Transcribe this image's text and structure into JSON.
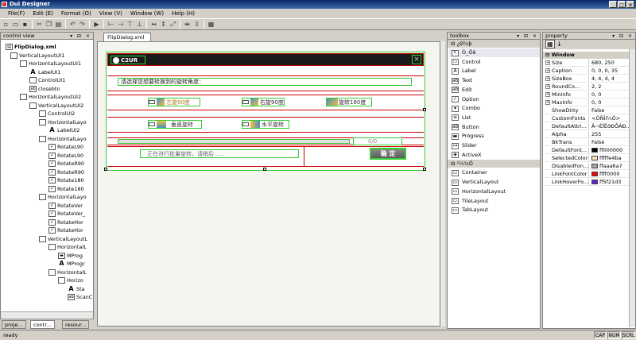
{
  "app": {
    "title": "Dui Designer",
    "window_buttons": [
      "_",
      "□",
      "×"
    ]
  },
  "menu": [
    "File(F)",
    "Edit (E)",
    "Format (O)",
    "View (V)",
    "Window (W)",
    "Help (H)"
  ],
  "toolbar_icons": [
    "new-icon",
    "open-icon",
    "save-icon",
    "cut-icon",
    "copy-icon",
    "paste-icon",
    "undo-icon",
    "redo-icon",
    "run-icon",
    "align-left-icon",
    "align-right-icon",
    "align-top-icon",
    "align-bottom-icon",
    "same-width-icon",
    "same-height-icon",
    "same-size-icon",
    "center-h-icon",
    "center-v-icon",
    "grid-icon"
  ],
  "control_view": {
    "title": "control view",
    "header_buttons": "▾ ⊟ ×",
    "tree": [
      {
        "label": "FlipDialog.xml",
        "icon": "xml",
        "bold": true
      },
      {
        "label": "VerticalLayoutUI1",
        "icon": "ctrl"
      },
      {
        "label": "HorizontalLayoutUI1",
        "icon": "ctrl"
      },
      {
        "label": "LabelUI1",
        "icon": "A"
      },
      {
        "label": "ControlUI1",
        "icon": "ctrl"
      },
      {
        "label": "closebtn",
        "icon": "ab"
      },
      {
        "label": "HorizontalLayoutUI2",
        "icon": "ctrl"
      },
      {
        "label": "VerticalLayoutUI2",
        "icon": "ctrl"
      },
      {
        "label": "ControlUI2",
        "icon": "ctrl"
      },
      {
        "label": "HorizontalLayo",
        "icon": "ctrl"
      },
      {
        "label": "LabelUI2",
        "icon": "A"
      },
      {
        "label": "HorizontalLayo",
        "icon": "ctrl"
      },
      {
        "label": "RotateL90",
        "icon": "chk"
      },
      {
        "label": "RotateL90",
        "icon": "chk"
      },
      {
        "label": "RotateR90",
        "icon": "chk"
      },
      {
        "label": "RotateR90",
        "icon": "chk"
      },
      {
        "label": "Rotate180",
        "icon": "chk"
      },
      {
        "label": "Rotate180",
        "icon": "chk"
      },
      {
        "label": "HorizontalLayo",
        "icon": "ctrl"
      },
      {
        "label": "RotateVer",
        "icon": "chk"
      },
      {
        "label": "RotateVer_",
        "icon": "chk"
      },
      {
        "label": "RotateHor",
        "icon": "chk"
      },
      {
        "label": "RotateHor",
        "icon": "chk"
      },
      {
        "label": "VerticalLayoutL",
        "icon": "ctrl"
      },
      {
        "label": "HorizontalL",
        "icon": "ctrl"
      },
      {
        "label": "MProg",
        "icon": "bar"
      },
      {
        "label": "MProgr",
        "icon": "A"
      },
      {
        "label": "HorizontalL",
        "icon": "ctrl"
      },
      {
        "label": "Horizo",
        "icon": "ctrl"
      },
      {
        "label": "Sta",
        "icon": "A"
      },
      {
        "label": "ScanC",
        "icon": "ab"
      }
    ],
    "tabs": [
      "proje...",
      "contr...",
      "resour..."
    ]
  },
  "document_tab": {
    "label": "FlipDialog.xml",
    "close": "×"
  },
  "dialog_preview": {
    "logo": "C2UR",
    "prompt": "请选择您想要转换到的旋转角度：",
    "options_row1": [
      "左旋90度",
      "右旋90度",
      "旋转180度"
    ],
    "options_row2": [
      "垂直旋转",
      "水平旋转"
    ],
    "progress_text": "0/0",
    "status_text": "正在进行批量旋转，请稍后......",
    "confirm_button": "确 定"
  },
  "toolbox": {
    "title": "toolbox",
    "section1": "¿Ø¼þ",
    "items": [
      "Ò_Õë",
      "Control",
      "Label",
      "Text",
      "Edit",
      "Option",
      "Combo",
      "List",
      "Button",
      "Progress",
      "Slider",
      "ActiveX"
    ],
    "section2": "²¼¾Ö",
    "layouts": [
      "Container",
      "VerticalLayout",
      "HorizontalLayout",
      "TileLayout",
      "TabLayout"
    ]
  },
  "property": {
    "title": "property",
    "category": "Window",
    "rows": [
      {
        "name": "Size",
        "value": "680, 250",
        "expand": true
      },
      {
        "name": "Caption",
        "value": "0, 0, 0, 35",
        "expand": true
      },
      {
        "name": "SizeBox",
        "value": "4, 4, 4, 4",
        "expand": true
      },
      {
        "name": "RoundCo...",
        "value": "2, 2",
        "expand": true
      },
      {
        "name": "MinInfo",
        "value": "0, 0",
        "expand": true
      },
      {
        "name": "MaxInfo",
        "value": "0, 0",
        "expand": true
      },
      {
        "name": "ShowDirty",
        "value": "False"
      },
      {
        "name": "CustomFonts",
        "value": "<ÒÑÌí¼Ó>"
      },
      {
        "name": "DefaultAttri...",
        "value": "Ä¬ÈÏÊôÐÔÁÐ..."
      },
      {
        "name": "Alpha",
        "value": "255"
      },
      {
        "name": "BkTrans",
        "value": "False"
      },
      {
        "name": "DefaultFont...",
        "value": "ff000000",
        "color": "#000000"
      },
      {
        "name": "SelectedColor",
        "value": "fffffe4ba",
        "color": "#ffe4ba"
      },
      {
        "name": "DisabledFon...",
        "value": "ffaaa6a7",
        "color": "#aaa6a7"
      },
      {
        "name": "LinkFontColor",
        "value": "ffff0000",
        "color": "#ff0000"
      },
      {
        "name": "LinkHoverFo...",
        "value": "ff5f21d3",
        "color": "#5f21d3"
      }
    ]
  },
  "status": {
    "text": "ready",
    "indicators": [
      "CAP",
      "NUM",
      "SCRL"
    ]
  }
}
